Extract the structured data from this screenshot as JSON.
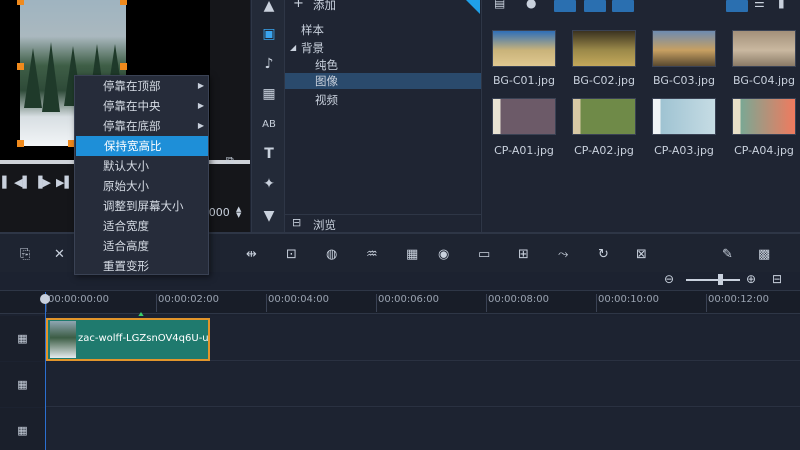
{
  "preview": {
    "timecode_tail": ":000"
  },
  "category_toolbar": {
    "icons": [
      "chevron-up-icon",
      "media-icon",
      "music-icon",
      "transition-icon",
      "title-icon",
      "text-icon",
      "filter-icon",
      "chevron-down-icon"
    ]
  },
  "library": {
    "add_label": "添加",
    "browse_label": "浏览",
    "tree": [
      {
        "label": "样本",
        "level": 0
      },
      {
        "label": "背景",
        "level": 0,
        "expanded": true
      },
      {
        "label": "纯色",
        "level": 1
      },
      {
        "label": "图像",
        "level": 1,
        "selected": true
      },
      {
        "label": "视频",
        "level": 1
      }
    ],
    "thumbnails": [
      {
        "name": "BG-C01.jpg",
        "colors": [
          "#2f6fb8",
          "#c9b37a",
          "#e0c890"
        ]
      },
      {
        "name": "BG-C02.jpg",
        "colors": [
          "#3a3220",
          "#9c8a4a",
          "#c4a85a"
        ]
      },
      {
        "name": "BG-C03.jpg",
        "colors": [
          "#6e8bb0",
          "#c7a062",
          "#5a4a30"
        ]
      },
      {
        "name": "BG-C04.jpg",
        "colors": [
          "#a3907a",
          "#c9b8a0",
          "#8a7a66"
        ]
      },
      {
        "name": "CP-A01.jpg",
        "colors": [
          "#e9e3d3",
          "#6c5a68",
          "#6c5a68"
        ]
      },
      {
        "name": "CP-A02.jpg",
        "colors": [
          "#d8c9a5",
          "#6f8a48",
          "#6f8a48"
        ]
      },
      {
        "name": "CP-A03.jpg",
        "colors": [
          "#f0f4f6",
          "#9fc3d2",
          "#c6dce4"
        ]
      },
      {
        "name": "CP-A04.jpg",
        "colors": [
          "#e8e0c8",
          "#7aa894",
          "#f07a5e"
        ]
      }
    ]
  },
  "context_menu": {
    "items": [
      {
        "label": "停靠在顶部",
        "submenu": true
      },
      {
        "label": "停靠在中央",
        "submenu": true
      },
      {
        "label": "停靠在底部",
        "submenu": true
      },
      {
        "label": "保持宽高比",
        "selected": true
      },
      {
        "label": "默认大小"
      },
      {
        "label": "原始大小"
      },
      {
        "label": "调整到屏幕大小"
      },
      {
        "label": "适合宽度"
      },
      {
        "label": "适合高度"
      },
      {
        "label": "重置变形"
      }
    ]
  },
  "timeline": {
    "ruler_labels": [
      "00:00:00:00",
      "00:00:02:00",
      "00:00:04:00",
      "00:00:06:00",
      "00:00:08:00",
      "00:00:10:00",
      "00:00:12:00"
    ],
    "clip_label": "zac-wolff-LGZsnOV4q6U-unsp",
    "track_icon": "grid-icon"
  },
  "colors": {
    "accent": "#1e8fd8",
    "clip": "#1f7a6e",
    "clip_border": "#e2952b",
    "handle": "#f08a1c"
  }
}
